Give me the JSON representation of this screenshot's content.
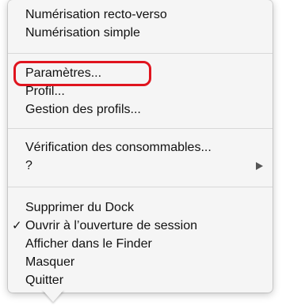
{
  "menu": {
    "group1": [
      "Numérisation recto-verso",
      "Numérisation simple"
    ],
    "group2": [
      "Paramètres...",
      "Profil...",
      "Gestion des profils..."
    ],
    "group3": [
      "Vérification des consommables...",
      "?"
    ],
    "group4": [
      "Supprimer du Dock",
      "Ouvrir à l’ouverture de session",
      "Afficher dans le Finder",
      "Masquer",
      "Quitter"
    ],
    "checkmark": "✓",
    "checked_item": "Ouvrir à l’ouverture de session"
  },
  "highlight_color": "#e0141e"
}
